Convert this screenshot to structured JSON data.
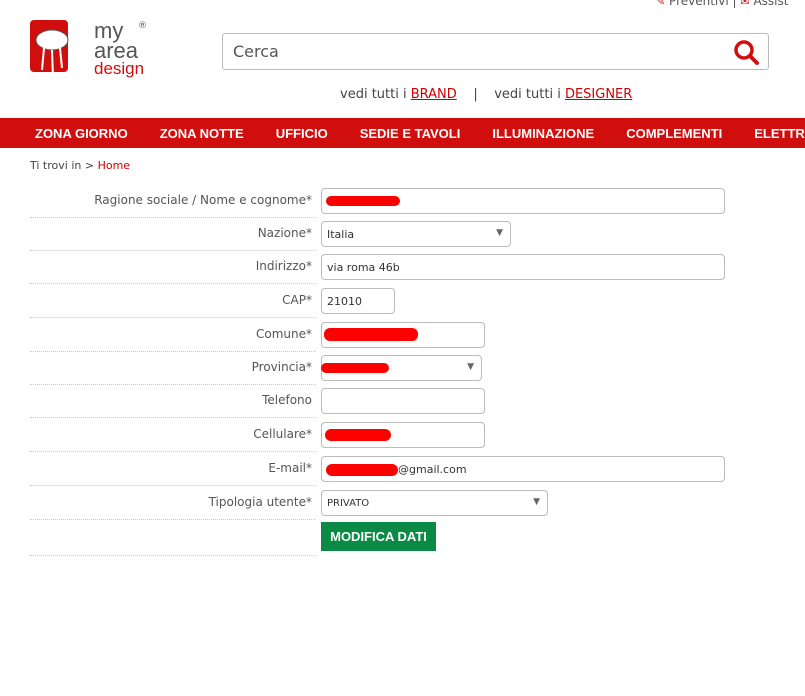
{
  "top_links": {
    "quotes": "Preventivi",
    "separator": "|",
    "assist": "Assist"
  },
  "logo": {
    "text": "my area design"
  },
  "search": {
    "placeholder": "Cerca"
  },
  "browse": {
    "prefix1": "vedi tutti i ",
    "brand": "BRAND",
    "sep": "|",
    "prefix2": "vedi tutti i ",
    "designer": "DESIGNER"
  },
  "nav": [
    "ZONA GIORNO",
    "ZONA NOTTE",
    "UFFICIO",
    "SEDIE E TAVOLI",
    "ILLUMINAZIONE",
    "COMPLEMENTI",
    "ELETTRO"
  ],
  "breadcrumb": {
    "prefix": "Ti trovi in",
    "arrow": ">",
    "home": "Home"
  },
  "form": {
    "ragione": {
      "label": "Ragione sociale / Nome e cognome*",
      "value": ""
    },
    "nazione": {
      "label": "Nazione*",
      "value": "Italia"
    },
    "indirizzo": {
      "label": "Indirizzo*",
      "value": "via roma 46b"
    },
    "cap": {
      "label": "CAP*",
      "value": "21010"
    },
    "comune": {
      "label": "Comune*",
      "value": ""
    },
    "provincia": {
      "label": "Provincia*",
      "value": ""
    },
    "telefono": {
      "label": "Telefono",
      "value": ""
    },
    "cellulare": {
      "label": "Cellulare*",
      "value": ""
    },
    "email": {
      "label": "E-mail*",
      "value": "@gmail.com"
    },
    "tipologia": {
      "label": "Tipologia utente*",
      "value": "PRIVATO"
    },
    "submit": "MODIFICA DATI"
  },
  "colors": {
    "brand_red": "#d10e0e",
    "button_green": "#0a8a45",
    "redaction": "#ff0000"
  }
}
